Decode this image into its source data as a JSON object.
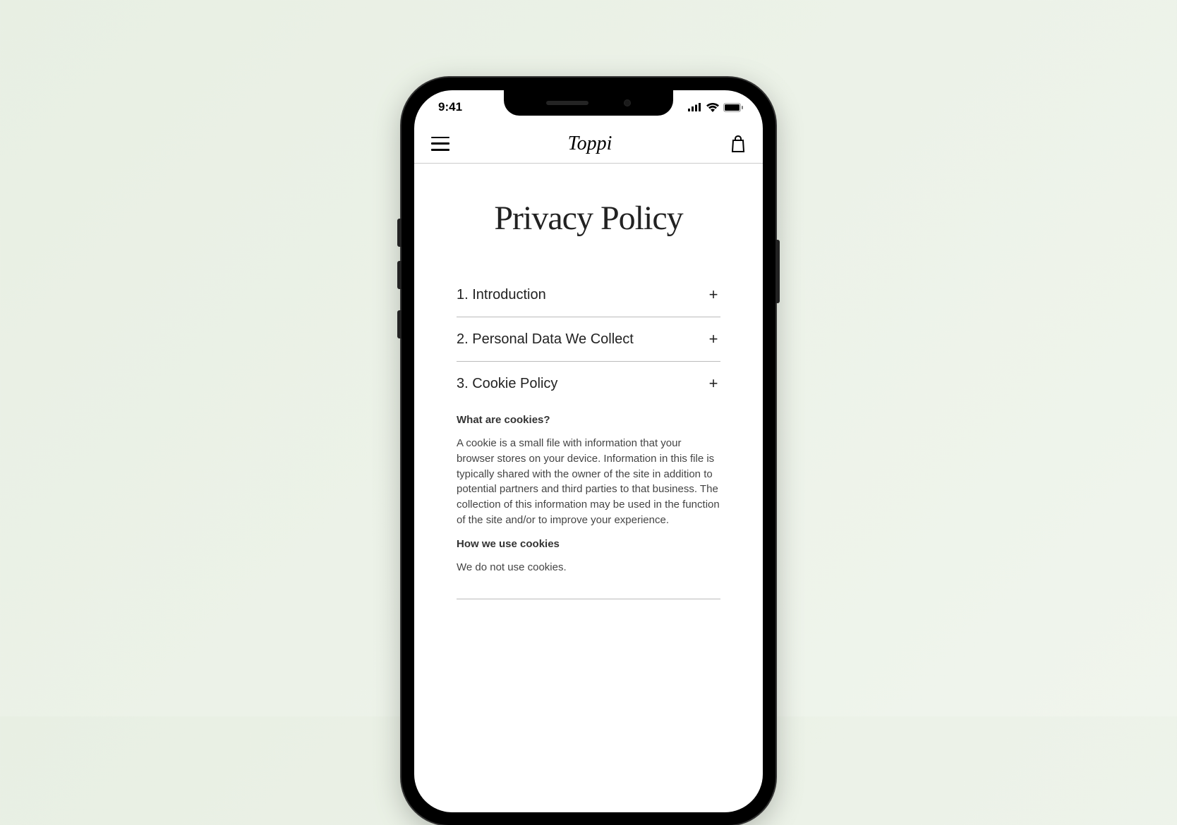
{
  "status": {
    "time": "9:41"
  },
  "header": {
    "brand": "Toppi"
  },
  "page": {
    "title": "Privacy Policy"
  },
  "sections": [
    {
      "label": "1. Introduction",
      "expanded": false
    },
    {
      "label": "2. Personal Data We Collect",
      "expanded": false
    },
    {
      "label": "3. Cookie Policy",
      "expanded": true
    }
  ],
  "cookie": {
    "h1": "What are cookies?",
    "p1": "A cookie is a small file with information that your browser stores on your device. Information in this file is typically shared with the owner of the site in addition to potential partners and third parties to that business. The collection of this information may be used in the function of the site and/or to improve your experience.",
    "h2": "How we use cookies",
    "p2": "We do not use cookies."
  },
  "icons": {
    "expand": "+"
  }
}
